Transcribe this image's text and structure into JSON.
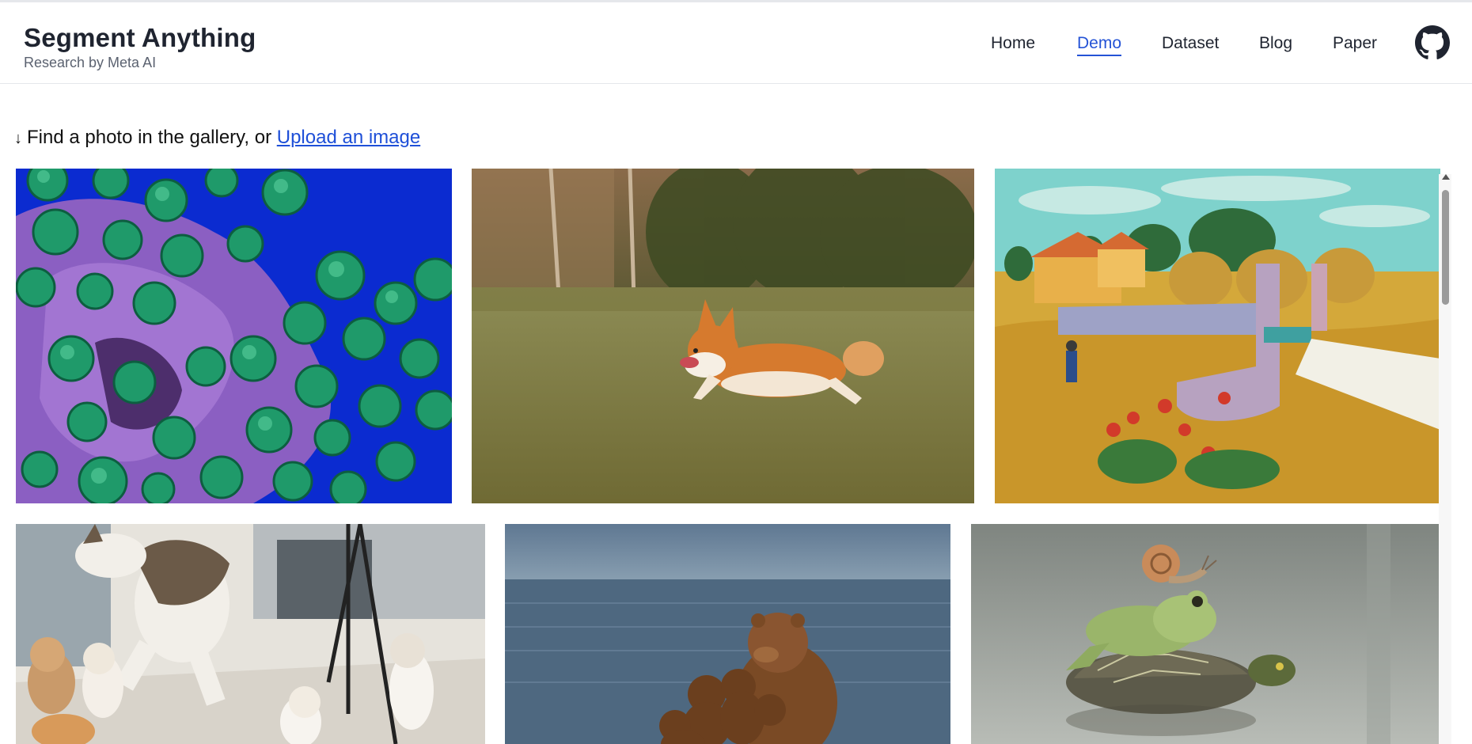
{
  "brand": {
    "title": "Segment Anything",
    "subtitle": "Research by Meta AI"
  },
  "nav": {
    "items": [
      {
        "label": "Home",
        "active": false
      },
      {
        "label": "Demo",
        "active": true
      },
      {
        "label": "Dataset",
        "active": false
      },
      {
        "label": "Blog",
        "active": false
      },
      {
        "label": "Paper",
        "active": false
      }
    ],
    "github_icon": "github-icon",
    "accent_color": "#2453d6"
  },
  "intro": {
    "arrow": "↓",
    "text": "Find a photo in the gallery, or",
    "link": "Upload an image"
  },
  "gallery": {
    "images": [
      {
        "subject": "green bacteria cells on purple cell, blue background"
      },
      {
        "subject": "corgi running across a grassy field"
      },
      {
        "subject": "painting of a farmhouse with stone wall and path"
      },
      {
        "subject": "cat jumping with kittens below"
      },
      {
        "subject": "brown bear with cubs in water"
      },
      {
        "subject": "frog with a snail on top of a turtle in water"
      }
    ]
  }
}
